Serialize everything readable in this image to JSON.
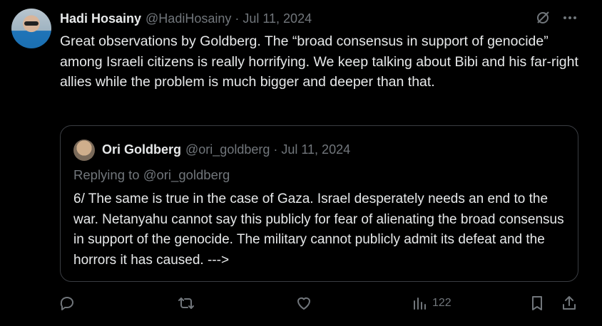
{
  "tweet": {
    "author_name": "Hadi Hosainy",
    "handle_meta": "@HadiHosainy · Jul 11, 2024",
    "text": "Great observations by Goldberg. The “broad consensus in support of genocide” among Israeli citizens is really horrifying. We keep talking about Bibi and his far-right allies while the problem is much bigger and deeper than that."
  },
  "quote": {
    "author_name": "Ori Goldberg",
    "handle_meta": "@ori_goldberg · Jul 11, 2024",
    "replying_to": "Replying to @ori_goldberg",
    "text": "6/ The same is true in the case of Gaza. Israel desperately needs an end to the war. Netanyahu cannot say this publicly for fear of alienating the broad consensus in support of the genocide. The military cannot publicly admit its defeat and the horrors it has caused. --->"
  },
  "actions": {
    "views_count": "122"
  },
  "icons": [
    "grok-icon",
    "more-icon",
    "reply-icon",
    "retweet-icon",
    "like-icon",
    "views-icon",
    "bookmark-icon",
    "share-icon"
  ],
  "colors": {
    "background": "#000000",
    "text_primary": "#e7e9ea",
    "text_secondary": "#71767b",
    "border": "#3a3d42"
  }
}
